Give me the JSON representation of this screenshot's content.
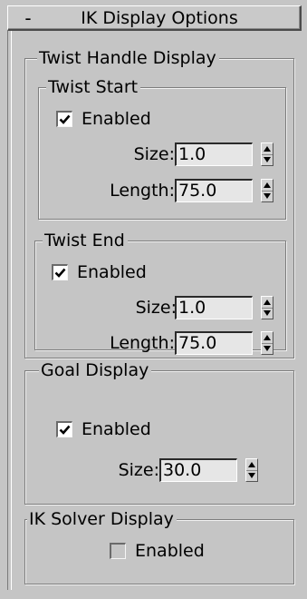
{
  "rollout": {
    "toggle": "-",
    "title": "IK Display Options"
  },
  "twist_handle": {
    "title": "Twist Handle Display",
    "twist_start": {
      "title": "Twist Start",
      "enabled_label": "Enabled",
      "enabled": true,
      "size_label": "Size:",
      "size_value": "1.0",
      "length_label": "Length:",
      "length_value": "75.0"
    },
    "twist_end": {
      "title": "Twist End",
      "enabled_label": "Enabled",
      "enabled": true,
      "size_label": "Size:",
      "size_value": "1.0",
      "length_label": "Length:",
      "length_value": "75.0"
    }
  },
  "goal_display": {
    "title": "Goal Display",
    "enabled_label": "Enabled",
    "enabled": true,
    "size_label": "Size:",
    "size_value": "30.0"
  },
  "ik_solver_display": {
    "title": "IK Solver Display",
    "enabled_label": "Enabled",
    "enabled": false
  },
  "icons": {
    "checkmark": "checkmark-icon",
    "spinner_up": "arrow-up-icon",
    "spinner_down": "arrow-down-icon"
  }
}
